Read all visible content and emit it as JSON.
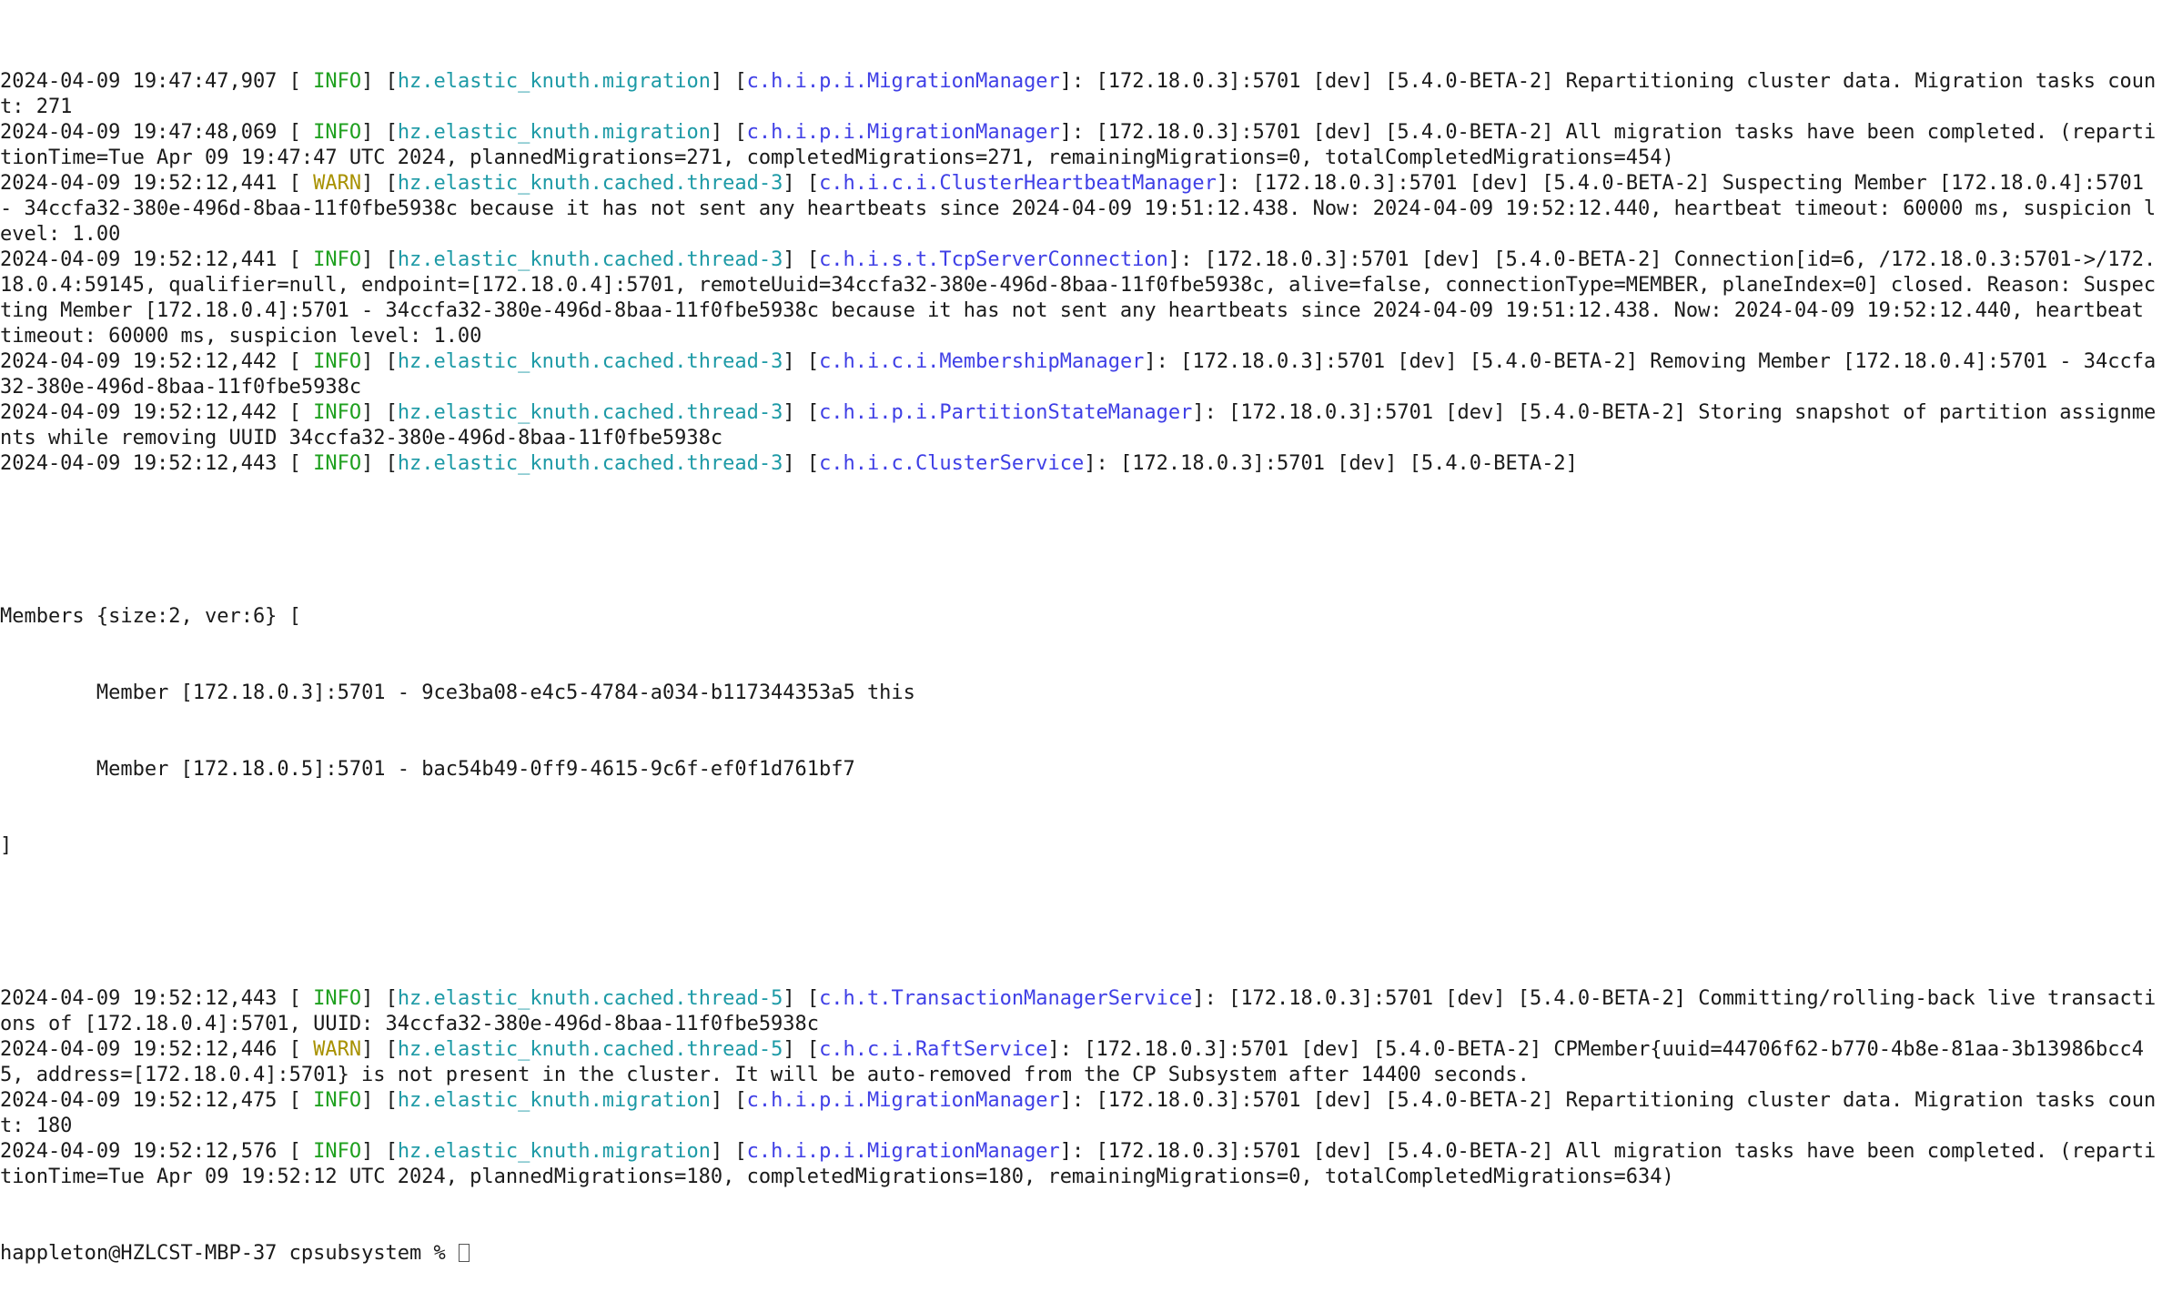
{
  "colors": {
    "background": "#ffffff",
    "text": "#1a1a1a",
    "level_info": "#1fa01f",
    "level_warn": "#a89100",
    "thread": "#1d9aa6",
    "class_name": "#3f3fe6"
  },
  "logs_before_members": [
    {
      "timestamp": "2024-04-09 19:47:47,907",
      "level": " INFO",
      "thread": "hz.elastic_knuth.migration",
      "class_name": "c.h.i.p.i.MigrationManager",
      "message": ": [172.18.0.3]:5701 [dev] [5.4.0-BETA-2] Repartitioning cluster data. Migration tasks count: 271"
    },
    {
      "timestamp": "2024-04-09 19:47:48,069",
      "level": " INFO",
      "thread": "hz.elastic_knuth.migration",
      "class_name": "c.h.i.p.i.MigrationManager",
      "message": ": [172.18.0.3]:5701 [dev] [5.4.0-BETA-2] All migration tasks have been completed. (repartitionTime=Tue Apr 09 19:47:47 UTC 2024, plannedMigrations=271, completedMigrations=271, remainingMigrations=0, totalCompletedMigrations=454)"
    },
    {
      "timestamp": "2024-04-09 19:52:12,441",
      "level": " WARN",
      "thread": "hz.elastic_knuth.cached.thread-3",
      "class_name": "c.h.i.c.i.ClusterHeartbeatManager",
      "message": ": [172.18.0.3]:5701 [dev] [5.4.0-BETA-2] Suspecting Member [172.18.0.4]:5701 - 34ccfa32-380e-496d-8baa-11f0fbe5938c because it has not sent any heartbeats since 2024-04-09 19:51:12.438. Now: 2024-04-09 19:52:12.440, heartbeat timeout: 60000 ms, suspicion level: 1.00"
    },
    {
      "timestamp": "2024-04-09 19:52:12,441",
      "level": " INFO",
      "thread": "hz.elastic_knuth.cached.thread-3",
      "class_name": "c.h.i.s.t.TcpServerConnection",
      "message": ": [172.18.0.3]:5701 [dev] [5.4.0-BETA-2] Connection[id=6, /172.18.0.3:5701->/172.18.0.4:59145, qualifier=null, endpoint=[172.18.0.4]:5701, remoteUuid=34ccfa32-380e-496d-8baa-11f0fbe5938c, alive=false, connectionType=MEMBER, planeIndex=0] closed. Reason: Suspecting Member [172.18.0.4]:5701 - 34ccfa32-380e-496d-8baa-11f0fbe5938c because it has not sent any heartbeats since 2024-04-09 19:51:12.438. Now: 2024-04-09 19:52:12.440, heartbeat timeout: 60000 ms, suspicion level: 1.00"
    },
    {
      "timestamp": "2024-04-09 19:52:12,442",
      "level": " INFO",
      "thread": "hz.elastic_knuth.cached.thread-3",
      "class_name": "c.h.i.c.i.MembershipManager",
      "message": ": [172.18.0.3]:5701 [dev] [5.4.0-BETA-2] Removing Member [172.18.0.4]:5701 - 34ccfa32-380e-496d-8baa-11f0fbe5938c"
    },
    {
      "timestamp": "2024-04-09 19:52:12,442",
      "level": " INFO",
      "thread": "hz.elastic_knuth.cached.thread-3",
      "class_name": "c.h.i.p.i.PartitionStateManager",
      "message": ": [172.18.0.3]:5701 [dev] [5.4.0-BETA-2] Storing snapshot of partition assignments while removing UUID 34ccfa32-380e-496d-8baa-11f0fbe5938c"
    },
    {
      "timestamp": "2024-04-09 19:52:12,443",
      "level": " INFO",
      "thread": "hz.elastic_knuth.cached.thread-3",
      "class_name": "c.h.i.c.ClusterService",
      "message": ": [172.18.0.3]:5701 [dev] [5.4.0-BETA-2]"
    }
  ],
  "members": {
    "header": "Members {size:2, ver:6} [",
    "lines": [
      "\tMember [172.18.0.3]:5701 - 9ce3ba08-e4c5-4784-a034-b117344353a5 this",
      "\tMember [172.18.0.5]:5701 - bac54b49-0ff9-4615-9c6f-ef0f1d761bf7"
    ],
    "footer": "]"
  },
  "logs_after_members": [
    {
      "timestamp": "2024-04-09 19:52:12,443",
      "level": " INFO",
      "thread": "hz.elastic_knuth.cached.thread-5",
      "class_name": "c.h.t.TransactionManagerService",
      "message": ": [172.18.0.3]:5701 [dev] [5.4.0-BETA-2] Committing/rolling-back live transactions of [172.18.0.4]:5701, UUID: 34ccfa32-380e-496d-8baa-11f0fbe5938c"
    },
    {
      "timestamp": "2024-04-09 19:52:12,446",
      "level": " WARN",
      "thread": "hz.elastic_knuth.cached.thread-5",
      "class_name": "c.h.c.i.RaftService",
      "message": ": [172.18.0.3]:5701 [dev] [5.4.0-BETA-2] CPMember{uuid=44706f62-b770-4b8e-81aa-3b13986bcc45, address=[172.18.0.4]:5701} is not present in the cluster. It will be auto-removed from the CP Subsystem after 14400 seconds."
    },
    {
      "timestamp": "2024-04-09 19:52:12,475",
      "level": " INFO",
      "thread": "hz.elastic_knuth.migration",
      "class_name": "c.h.i.p.i.MigrationManager",
      "message": ": [172.18.0.3]:5701 [dev] [5.4.0-BETA-2] Repartitioning cluster data. Migration tasks count: 180"
    },
    {
      "timestamp": "2024-04-09 19:52:12,576",
      "level": " INFO",
      "thread": "hz.elastic_knuth.migration",
      "class_name": "c.h.i.p.i.MigrationManager",
      "message": ": [172.18.0.3]:5701 [dev] [5.4.0-BETA-2] All migration tasks have been completed. (repartitionTime=Tue Apr 09 19:52:12 UTC 2024, plannedMigrations=180, completedMigrations=180, remainingMigrations=0, totalCompletedMigrations=634)"
    }
  ],
  "prompt": {
    "user_host": "happleton@HZLCST-MBP-37",
    "directory": "cpsubsystem",
    "symbol": "%"
  }
}
